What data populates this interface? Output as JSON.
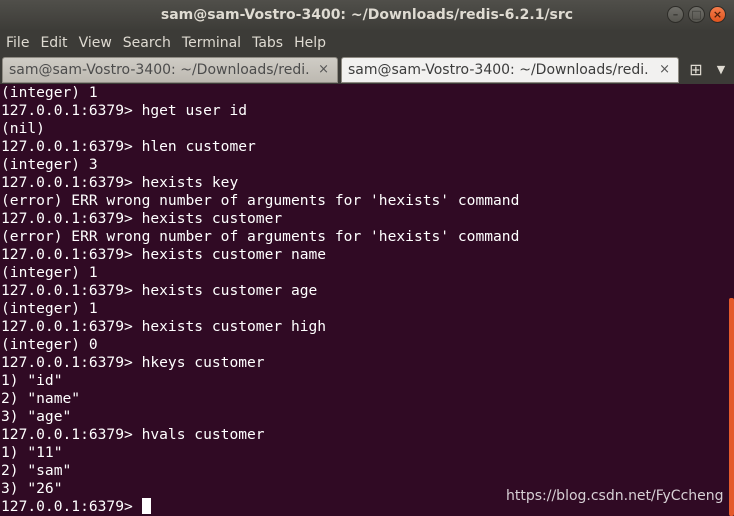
{
  "window": {
    "title": "sam@sam-Vostro-3400: ~/Downloads/redis-6.2.1/src",
    "controls": {
      "minimize_icon": "–",
      "maximize_icon": "□",
      "close_icon": "×"
    }
  },
  "menubar": {
    "items": [
      "File",
      "Edit",
      "View",
      "Search",
      "Terminal",
      "Tabs",
      "Help"
    ]
  },
  "tabs": [
    {
      "label": "sam@sam-Vostro-3400: ~/Downloads/redi...",
      "close": "×",
      "active": false
    },
    {
      "label": "sam@sam-Vostro-3400: ~/Downloads/redi...",
      "close": "×",
      "active": true
    }
  ],
  "tabbar": {
    "new_tab_icon": "⊞",
    "menu_icon": "▼"
  },
  "terminal": {
    "lines": [
      "(integer) 1",
      "127.0.0.1:6379> hget user id",
      "(nil)",
      "127.0.0.1:6379> hlen customer",
      "(integer) 3",
      "127.0.0.1:6379> hexists key",
      "(error) ERR wrong number of arguments for 'hexists' command",
      "127.0.0.1:6379> hexists customer",
      "(error) ERR wrong number of arguments for 'hexists' command",
      "127.0.0.1:6379> hexists customer name",
      "(integer) 1",
      "127.0.0.1:6379> hexists customer age",
      "(integer) 1",
      "127.0.0.1:6379> hexists customer high",
      "(integer) 0",
      "127.0.0.1:6379> hkeys customer",
      "1) \"id\"",
      "2) \"name\"",
      "3) \"age\"",
      "127.0.0.1:6379> hvals customer",
      "1) \"11\"",
      "2) \"sam\"",
      "3) \"26\""
    ],
    "prompt": "127.0.0.1:6379> "
  },
  "watermark": "https://blog.csdn.net/FyCcheng",
  "colors": {
    "terminal_bg": "#300a24",
    "terminal_fg": "#ffffff",
    "scroll_thumb": "#e45a2c",
    "close_button": "#e0541e"
  }
}
